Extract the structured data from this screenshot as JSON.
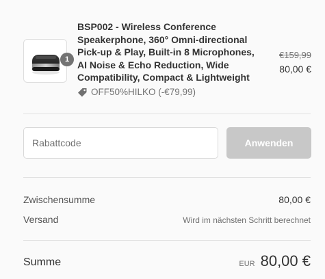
{
  "line_item": {
    "quantity": "1",
    "title": "BSP002 - Wireless Conference Speakerphone, 360° Omni-directional Pick-up & Play, Built-in 8 Microphones, AI Noise & Echo Reduction, Wide Compatibility, Compact & Lightweight",
    "discount_code": "OFF50%HILKO (-€79,99)",
    "original_price": "€159,99",
    "price": "80,00 €",
    "thumbnail_icon": "speakerphone-product-image",
    "discount_icon": "tag-icon"
  },
  "coupon": {
    "placeholder": "Rabattcode",
    "value": "",
    "apply_label": "Anwenden"
  },
  "summary": {
    "subtotal_label": "Zwischensumme",
    "subtotal_value": "80,00 €",
    "shipping_label": "Versand",
    "shipping_value": "Wird im nächsten Schritt berechnet",
    "total_label": "Summe",
    "total_currency": "EUR",
    "total_value": "80,00 €"
  },
  "colors": {
    "background": "#fafafa",
    "badge": "#737373",
    "button_disabled": "#c8c8c8",
    "divider": "#e1e1e1"
  }
}
